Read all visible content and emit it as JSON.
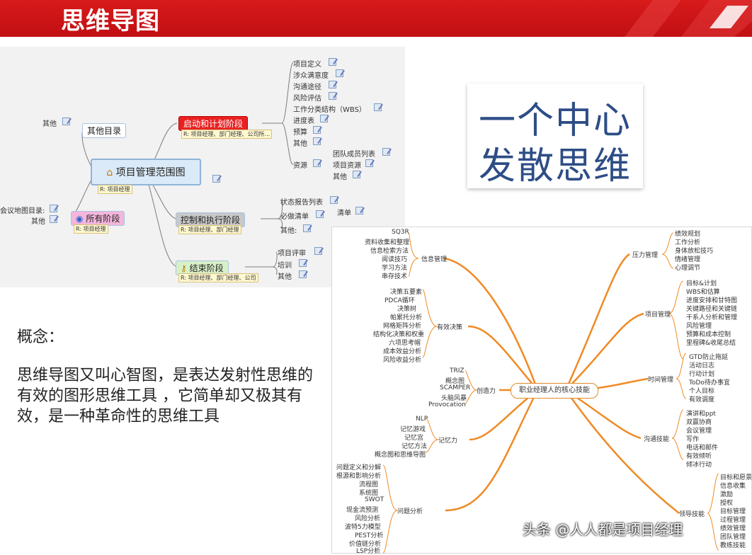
{
  "header": {
    "title": "思维导图"
  },
  "mindmap1": {
    "root": "项目管理范围图",
    "root_tag": "R: 项目经理",
    "left_branches": [
      {
        "label": "其他目录",
        "leaves": [
          "其他"
        ]
      },
      {
        "label": "所有阶段",
        "tag": "R: 项目经理",
        "leaves": [
          "会议地图目录:",
          "其他"
        ]
      }
    ],
    "right_branches": [
      {
        "label": "启动和计划阶段",
        "tag": "R: 项目经理、部门经理、公司所...",
        "leaves": [
          "项目定义",
          "涉众满意度",
          "沟通途径",
          "风险评估",
          "工作分类结构（WBS）",
          "进度表",
          "预算",
          "其他",
          "资源"
        ],
        "sub": [
          "团队成员列表",
          "项目资源",
          "其他"
        ]
      },
      {
        "label": "控制和执行阶段",
        "tag": "R: 项目经理、部门经理",
        "leaves": [
          "状态报告列表",
          "必做清单",
          "其他:"
        ],
        "sub": [
          "清单"
        ]
      },
      {
        "label": "结束阶段",
        "tag": "R: 项目经理、部门经理、公司",
        "leaves": [
          "项目评审",
          "培训",
          "其他"
        ]
      }
    ]
  },
  "concept_card": {
    "line1": "一个中心",
    "line2": "发散思维"
  },
  "concept_text": {
    "heading": "概念：",
    "body": "思维导图又叫心智图，是表达发射性思维的有效的图形思维工具 ，它简单却又极其有效，是一种革命性的思维工具"
  },
  "mindmap2": {
    "center": "职业经理人的核心技能",
    "left_branches": [
      {
        "label": "信息管理",
        "leaves": [
          "SQ3R",
          "资料收集和整理",
          "信息检索方法",
          "阅读技巧",
          "学习方法",
          "串存技术"
        ]
      },
      {
        "label": "有效决策",
        "leaves": [
          "决策五要素",
          "PDCA循环",
          "决策树",
          "帕累托分析",
          "网格矩阵分析",
          "结构化决策和权重",
          "六项思考帽",
          "成本效益分析",
          "风险收益分析"
        ]
      },
      {
        "label": "创造力",
        "leaves": [
          "TRIZ",
          "概念图",
          "SCAMPER",
          "头脑风暴",
          "Provocation"
        ]
      },
      {
        "label": "记忆力",
        "leaves": [
          "NLP",
          "记忆游戏",
          "记忆宫",
          "记忆方法",
          "概念图和思维导图"
        ]
      },
      {
        "label": "问题分析",
        "leaves": [
          "问题定义和分解",
          "根源和影响分析",
          "流程图",
          "系统图",
          "SWOT",
          "现金流预测",
          "风险分析",
          "波特5力模型",
          "PEST分析",
          "价值链分析",
          "LSP分析"
        ]
      }
    ],
    "right_branches": [
      {
        "label": "压力管理",
        "leaves": [
          "绩效规划",
          "工作分析",
          "身体放松技巧",
          "情绪管理",
          "心理调节"
        ]
      },
      {
        "label": "项目管理",
        "leaves": [
          "目标&计划",
          "WBS和估算",
          "进度安排和甘特图",
          "关键路径和关键链",
          "干系人分析和管理",
          "风险管理",
          "预算和成本控制",
          "里程碑&收尾总结"
        ]
      },
      {
        "label": "时间管理",
        "leaves": [
          "GTD防止拖延",
          "活动日志",
          "行动计划",
          "ToDo待办事宜",
          "个人目标",
          "有效调度"
        ]
      },
      {
        "label": "沟通技能",
        "leaves": [
          "演讲和ppt",
          "双赢协商",
          "会议管理",
          "写作",
          "电话和邮件",
          "有效倾听",
          "倾冰行动"
        ]
      },
      {
        "label": "领导技能",
        "leaves": [
          "目标和愿景",
          "信息收集",
          "激励",
          "授权",
          "目标管理",
          "过程管理",
          "绩效管理",
          "团队管理",
          "教练技能"
        ]
      }
    ]
  },
  "watermark": "头条 @人人都是项目经理",
  "colors": {
    "header": "#c8141a",
    "branch_line": "#f08a24",
    "concept_text": "#2d4d86"
  }
}
